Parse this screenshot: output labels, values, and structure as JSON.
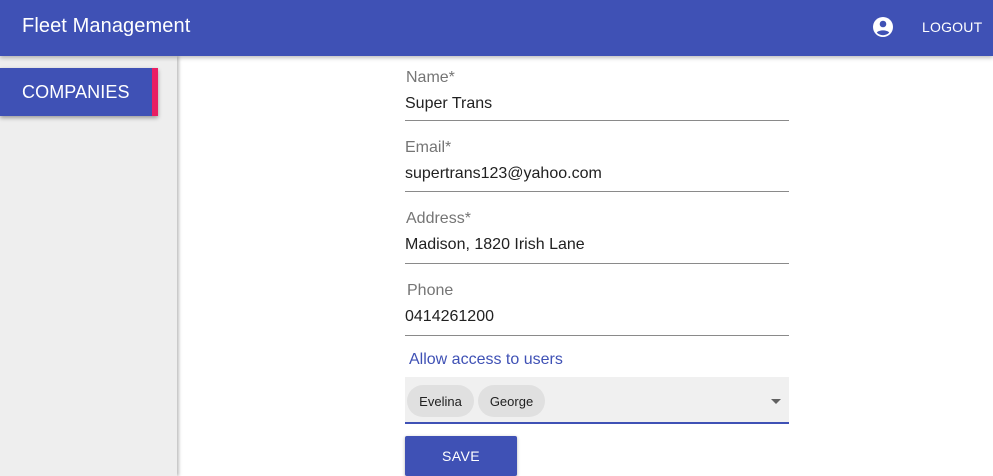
{
  "appbar": {
    "title": "Fleet Management",
    "account_icon": "account-circle-icon",
    "logout_label": "LOGOUT"
  },
  "sidebar": {
    "items": [
      {
        "label": "COMPANIES",
        "active": true
      }
    ]
  },
  "form": {
    "name": {
      "label": "Name*",
      "value": "Super Trans"
    },
    "email": {
      "label": "Email*",
      "value": "supertrans123@yahoo.com"
    },
    "address": {
      "label": "Address*",
      "value": "Madison, 1820 Irish Lane"
    },
    "phone": {
      "label": "Phone",
      "value": "0414261200"
    },
    "access": {
      "label": "Allow access to users",
      "chips": [
        "Evelina",
        "George"
      ]
    },
    "save_label": "SAVE"
  },
  "colors": {
    "primary": "#3f51b5",
    "accent": "#e91e63",
    "sidebar_bg": "#eeeeee"
  }
}
